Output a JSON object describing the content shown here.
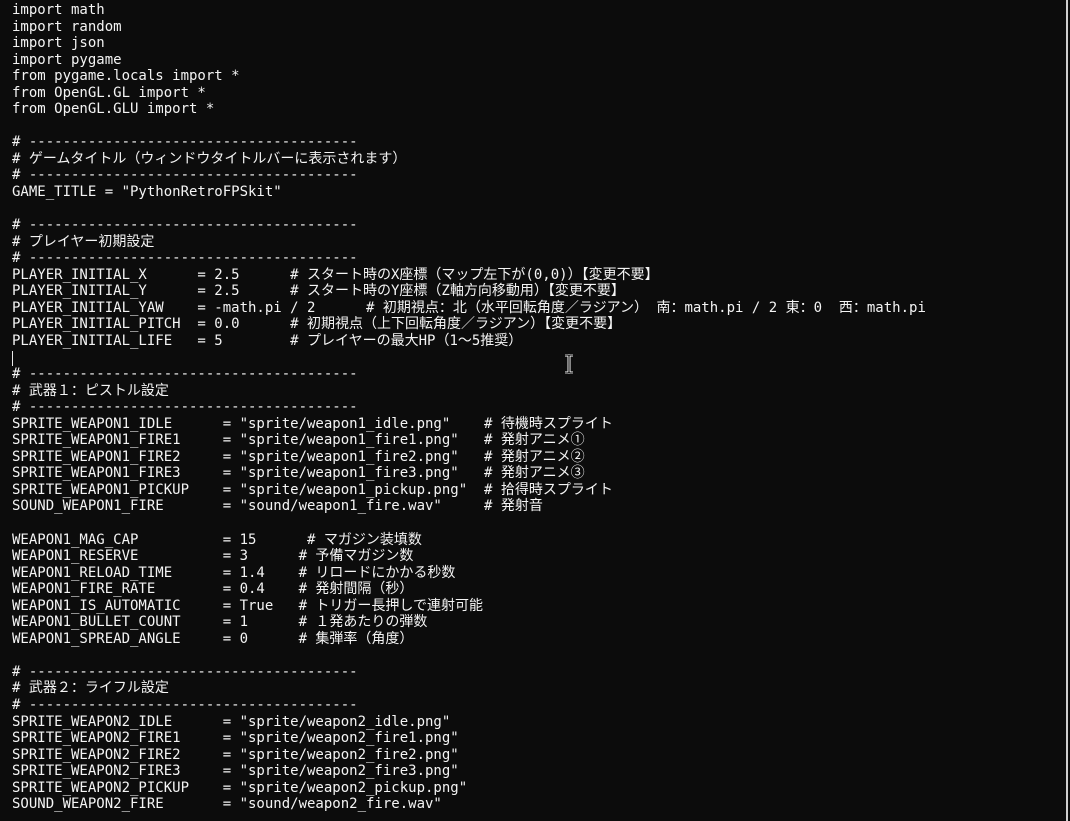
{
  "editor": {
    "lines": [
      "import math",
      "import random",
      "import json",
      "import pygame",
      "from pygame.locals import *",
      "from OpenGL.GL import *",
      "from OpenGL.GLU import *",
      "",
      "# ---------------------------------------",
      "# ゲームタイトル（ウィンドウタイトルバーに表示されます）",
      "# ---------------------------------------",
      "GAME_TITLE = \"PythonRetroFPSkit\"",
      "",
      "# ---------------------------------------",
      "# プレイヤー初期設定",
      "# ---------------------------------------",
      "PLAYER_INITIAL_X      = 2.5      # スタート時のX座標（マップ左下が(0,0)）【変更不要】",
      "PLAYER_INITIAL_Y      = 2.5      # スタート時のY座標（Z軸方向移動用）【変更不要】",
      "PLAYER_INITIAL_YAW    = -math.pi / 2      # 初期視点：北（水平回転角度／ラジアン） 南：math.pi / 2 東：0  西：math.pi",
      "PLAYER_INITIAL_PITCH  = 0.0      # 初期視点（上下回転角度／ラジアン）【変更不要】",
      "PLAYER_INITIAL_LIFE   = 5        # プレイヤーの最大HP（1～5推奨）",
      "",
      "# ---------------------------------------",
      "# 武器１：ピストル設定",
      "# ---------------------------------------",
      "SPRITE_WEAPON1_IDLE      = \"sprite/weapon1_idle.png\"    # 待機時スプライト",
      "SPRITE_WEAPON1_FIRE1     = \"sprite/weapon1_fire1.png\"   # 発射アニメ①",
      "SPRITE_WEAPON1_FIRE2     = \"sprite/weapon1_fire2.png\"   # 発射アニメ②",
      "SPRITE_WEAPON1_FIRE3     = \"sprite/weapon1_fire3.png\"   # 発射アニメ③",
      "SPRITE_WEAPON1_PICKUP    = \"sprite/weapon1_pickup.png\"  # 拾得時スプライト",
      "SOUND_WEAPON1_FIRE       = \"sound/weapon1_fire.wav\"     # 発射音",
      "",
      "WEAPON1_MAG_CAP          = 15      # マガジン装填数",
      "WEAPON1_RESERVE          = 3      # 予備マガジン数",
      "WEAPON1_RELOAD_TIME      = 1.4    # リロードにかかる秒数",
      "WEAPON1_FIRE_RATE        = 0.4    # 発射間隔（秒）",
      "WEAPON1_IS_AUTOMATIC     = True   # トリガー長押しで連射可能",
      "WEAPON1_BULLET_COUNT     = 1      # １発あたりの弾数",
      "WEAPON1_SPREAD_ANGLE     = 0      # 集弾率（角度）",
      "",
      "# ---------------------------------------",
      "# 武器２：ライフル設定",
      "# ---------------------------------------",
      "SPRITE_WEAPON2_IDLE      = \"sprite/weapon2_idle.png\"",
      "SPRITE_WEAPON2_FIRE1     = \"sprite/weapon2_fire1.png\"",
      "SPRITE_WEAPON2_FIRE2     = \"sprite/weapon2_fire2.png\"",
      "SPRITE_WEAPON2_FIRE3     = \"sprite/weapon2_fire3.png\"",
      "SPRITE_WEAPON2_PICKUP    = \"sprite/weapon2_pickup.png\"",
      "SOUND_WEAPON2_FIRE       = \"sound/weapon2_fire.wav\""
    ]
  },
  "colors": {
    "background": "#0c0c0c",
    "text": "#f4f4f4"
  },
  "icons": {
    "mouse_cursor": "text-ibeam-cursor-icon",
    "text_caret": "text-caret"
  }
}
